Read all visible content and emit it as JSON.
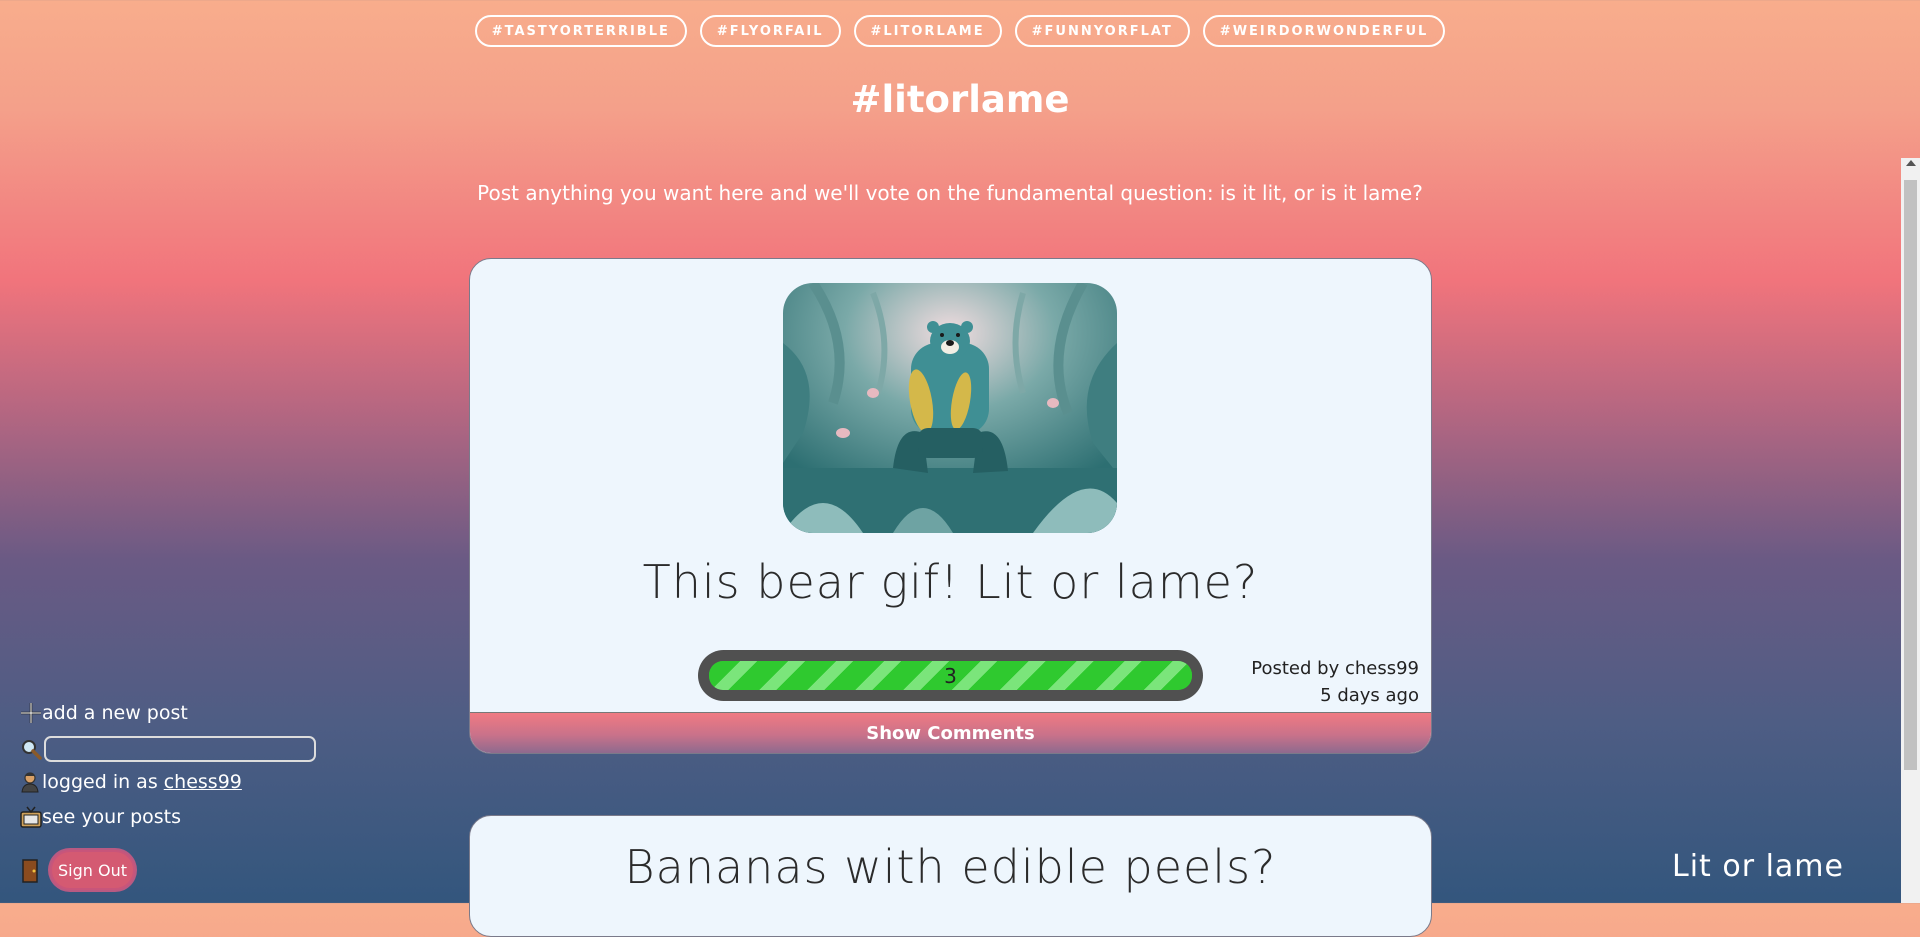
{
  "tags": [
    "#TASTYORTERRIBLE",
    "#FLYORFAIL",
    "#LITORLAME",
    "#FUNNYORFLAT",
    "#WEIRDORWONDERFUL"
  ],
  "page": {
    "title": "#litorlame",
    "subtitle": "Post anything you want here and we'll vote on the fundamental question: is it lit, or is it lame?"
  },
  "posts": [
    {
      "title": "This bear gif! Lit or lame?",
      "image_icon": "bear-gif-image",
      "vote_count": "3",
      "vote_fraction": 1.0,
      "posted_by": "Posted by chess99",
      "posted_ago": "5 days ago",
      "comments_label": "Show Comments"
    },
    {
      "title": "Bananas with edible peels?"
    }
  ],
  "sidebar": {
    "add_post_label": "add a new post",
    "search_value": "",
    "logged_in_prefix": "logged in as",
    "username": "chess99",
    "see_posts_label": "see your posts",
    "sign_out_label": "Sign Out"
  },
  "brand": "Lit or lame",
  "colors": {
    "card_bg": "#eef6fd",
    "vote_green": "#2fc92f",
    "sign_out": "#d45a72"
  }
}
